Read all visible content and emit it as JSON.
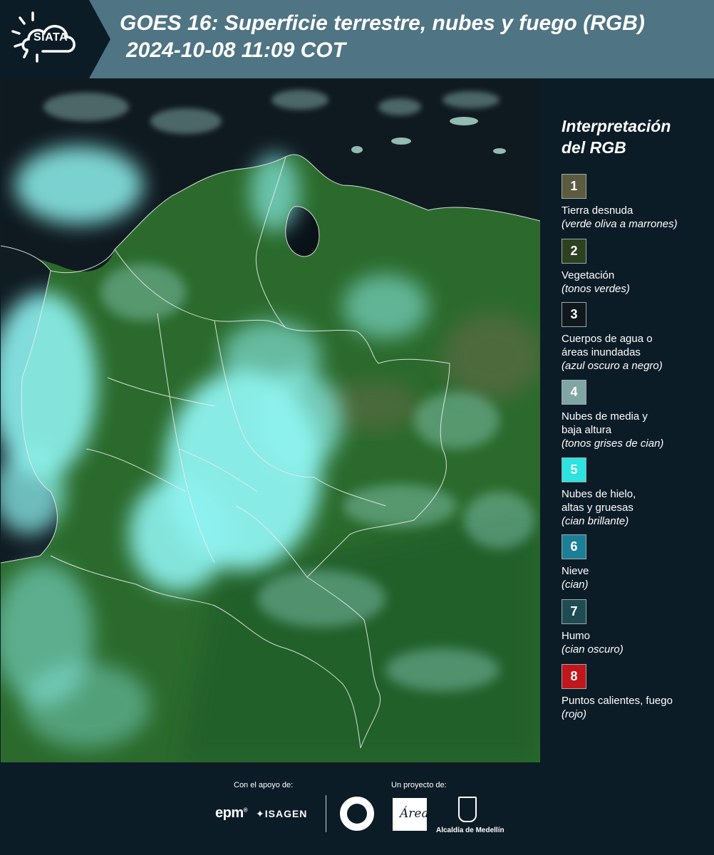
{
  "header": {
    "logo_text": "SIATA",
    "title_line1": "GOES 16: Superficie terrestre, nubes y fuego (RGB)",
    "title_line2": "2024-10-08 11:09 COT"
  },
  "legend": {
    "title_line1": "Interpretación",
    "title_line2": "del RGB",
    "items": [
      {
        "num": "1",
        "label": "Tierra desnuda",
        "note": "(verde oliva a marrones)",
        "color": "#5c5b40"
      },
      {
        "num": "2",
        "label": "Vegetación",
        "note": "(tonos verdes)",
        "color": "#2d4020"
      },
      {
        "num": "3",
        "label": "Cuerpos de agua o áreas inundadas",
        "note": "(azul oscuro a negro)",
        "color": "#10181e"
      },
      {
        "num": "4",
        "label": "Nubes de media y baja altura",
        "note": "(tonos grises de cian)",
        "color": "#7fa6a4"
      },
      {
        "num": "5",
        "label": "Nubes de hielo, altas y gruesas",
        "note": "(cian brillante)",
        "color": "#2de3e0"
      },
      {
        "num": "6",
        "label": "Nieve",
        "note": "(cian)",
        "color": "#1c7f98"
      },
      {
        "num": "7",
        "label": "Humo",
        "note": "(cian oscuro)",
        "color": "#1f4c53"
      },
      {
        "num": "8",
        "label": "Puntos calientes, fuego",
        "note": "(rojo)",
        "color": "#c0161c"
      }
    ]
  },
  "footer": {
    "support_label": "Con el apoyo de:",
    "project_label": "Un proyecto de:",
    "sponsor1": "epm",
    "sponsor2": "ISAGEN",
    "area_word": "Área",
    "partner3": "Alcaldía de Medellín"
  },
  "colors": {
    "header_bg": "#4f7483",
    "panel_bg": "#0c1c27",
    "vegetation": "#2c6b2c",
    "cloud": "#8ef2ef",
    "sea": "#0f1a20"
  }
}
